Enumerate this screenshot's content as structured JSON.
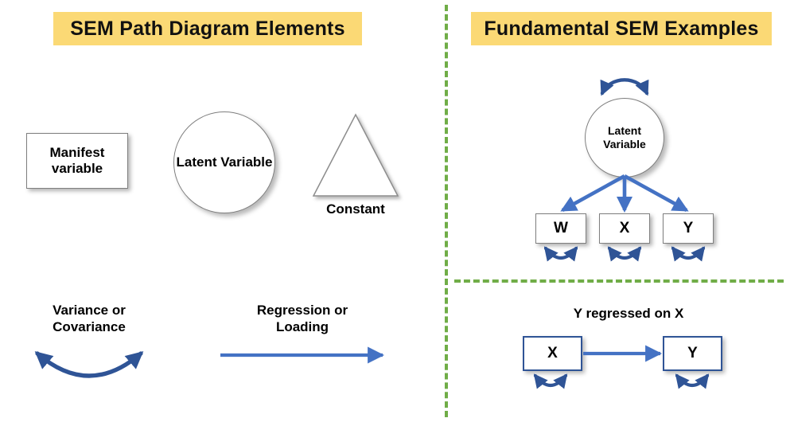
{
  "panels": {
    "left": {
      "title": "SEM Path Diagram Elements",
      "elements": {
        "manifest": "Manifest\nvariable",
        "latent": "Latent\nVariable",
        "constant_label": "Constant",
        "variance_label": "Variance or\nCovariance",
        "regression_label": "Regression or\nLoading"
      }
    },
    "right": {
      "title": "Fundamental SEM Examples",
      "example_top": {
        "latent": "Latent\nVariable",
        "indicators": [
          "W",
          "X",
          "Y"
        ]
      },
      "example_bottom": {
        "caption": "Y regressed on X",
        "predictor": "X",
        "outcome": "Y"
      }
    }
  },
  "icons": {
    "variance_arrow": "double-headed-curved-arrow",
    "regression_arrow": "single-headed-straight-arrow",
    "self_loop": "self-loop-variance-arrow",
    "triangle": "triangle-constant-shape"
  },
  "colors": {
    "banner_yellow": "#FBD975",
    "divider_green": "#70AD47",
    "regression_blue": "#4472C4",
    "variance_blue": "#2F5496",
    "shape_gray": "#7F7F7F",
    "text_black": "#000000"
  }
}
